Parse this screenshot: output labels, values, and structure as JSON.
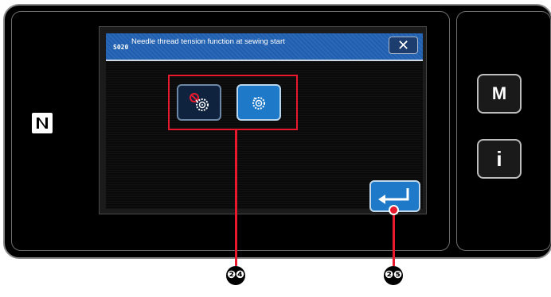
{
  "dialog": {
    "code": "S020",
    "title": "Needle thread tension function at sewing start",
    "close_icon": "close-icon"
  },
  "options": [
    {
      "name": "tension-off",
      "icon": "thread-tension-disabled-icon",
      "selected": false
    },
    {
      "name": "tension-on",
      "icon": "thread-tension-icon",
      "selected": true
    }
  ],
  "side_buttons": {
    "menu_label": "M",
    "info_label": "i"
  },
  "callouts": {
    "options_number": "❷❹",
    "enter_number": "❷❺"
  },
  "colors": {
    "title_bar": "#1f5fb0",
    "selected_button": "#1e79c8",
    "unselected_button": "#10233e",
    "callout_red": "#e8192c"
  }
}
